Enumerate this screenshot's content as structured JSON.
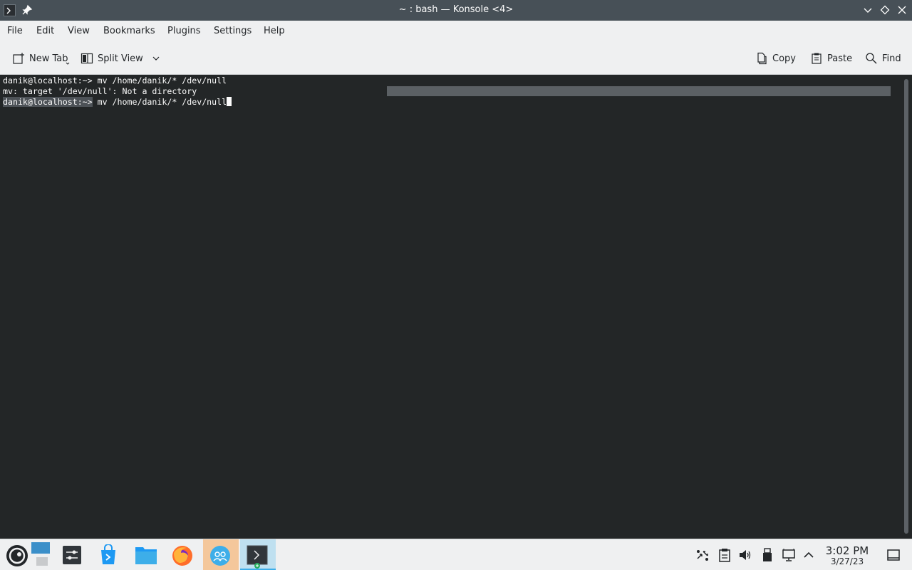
{
  "window": {
    "title": "~ : bash — Konsole <4>",
    "icons": [
      "terminal-icon",
      "pin-icon",
      "minimize-icon",
      "maximize-icon",
      "close-icon"
    ]
  },
  "menu": {
    "file": "File",
    "edit": "Edit",
    "view": "View",
    "bookmarks": "Bookmarks",
    "plugins": "Plugins",
    "settings": "Settings",
    "help": "Help"
  },
  "toolbar": {
    "new_tab": "New Tab",
    "split_view": "Split View",
    "copy": "Copy",
    "paste": "Paste",
    "find": "Find"
  },
  "terminal": {
    "line1_prompt": "danik@localhost:~>",
    "line1_cmd": " mv /home/danik/* /dev/null",
    "line2": "mv: target '/dev/null': Not a directory",
    "line3_prompt": "danik@localhost:~>",
    "line3_cmd": " mv /home/danik/* /dev/null"
  },
  "taskbar": {
    "apps": [
      "opensuse-launcher-icon",
      "desktop-pager-icon",
      "system-settings-icon",
      "discover-store-icon",
      "file-manager-icon",
      "firefox-icon",
      "kde-connect-icon",
      "konsole-icon"
    ],
    "tray": [
      "network-share-icon",
      "clipboard-icon",
      "volume-icon",
      "usb-icon",
      "network-icon",
      "tray-expand-icon",
      "show-desktop-icon"
    ],
    "clock_time": "3:02 PM",
    "clock_date": "3/27/23"
  },
  "colors": {
    "titlebar": "#475057",
    "terminal_bg": "#232627",
    "panel_bg": "#eff0f1",
    "accent": "#3daee9"
  }
}
